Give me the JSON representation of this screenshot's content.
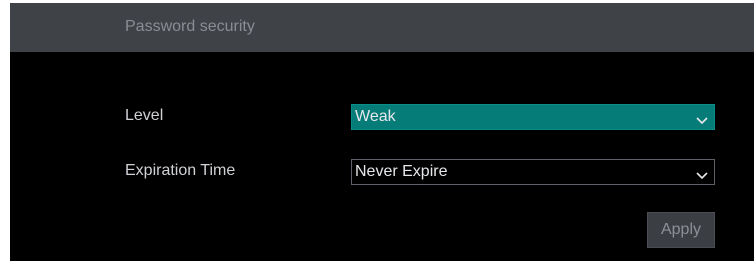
{
  "header": {
    "title": "Password security"
  },
  "form": {
    "level": {
      "label": "Level",
      "value": "Weak"
    },
    "expiration": {
      "label": "Expiration Time",
      "value": "Never Expire"
    }
  },
  "actions": {
    "apply_label": "Apply"
  },
  "colors": {
    "accent": "#067c79",
    "header_bg": "#3f4247",
    "panel_bg": "#000000"
  },
  "icons": {
    "dropdown": "chevron-down-icon"
  }
}
